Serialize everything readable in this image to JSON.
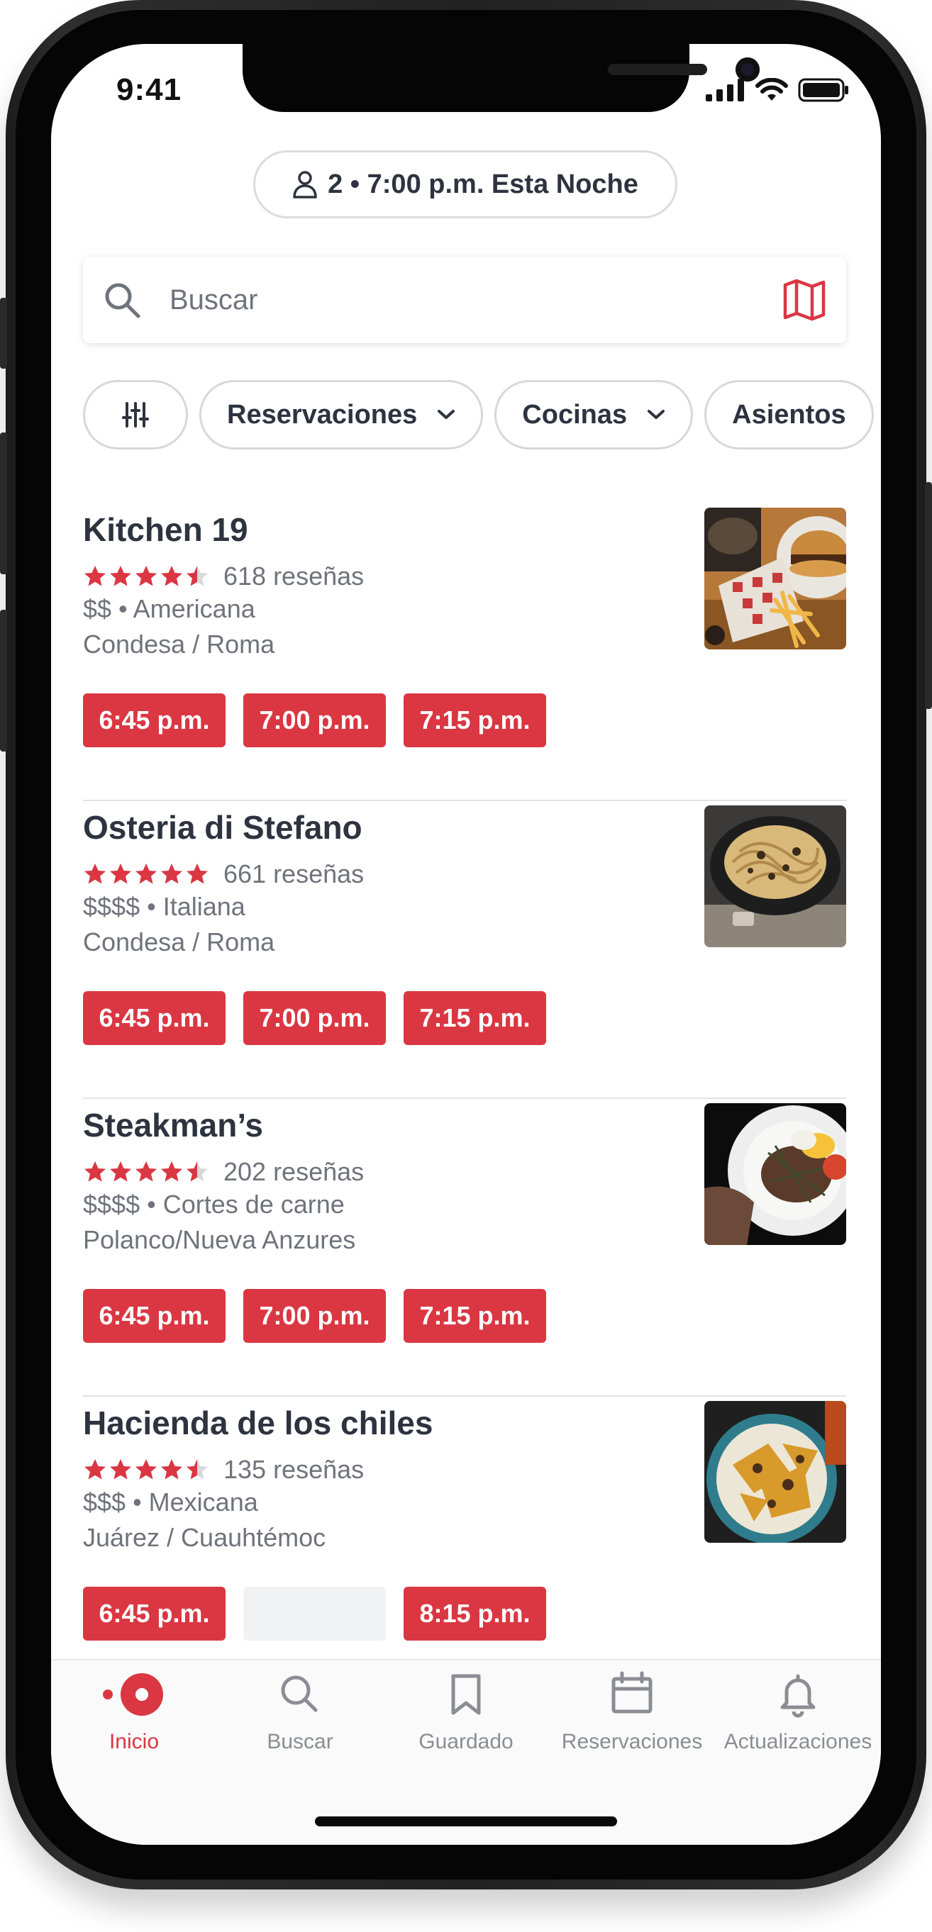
{
  "status_bar": {
    "time": "9:41"
  },
  "party": {
    "text": "2 • 7:00 p.m. Esta Noche"
  },
  "search": {
    "placeholder": "Buscar"
  },
  "filters": [
    {
      "label": "Reservaciones"
    },
    {
      "label": "Cocinas"
    },
    {
      "label": "Asientos"
    }
  ],
  "restaurants": [
    {
      "name": "Kitchen 19",
      "rating": 4.5,
      "reviews": "618 reseñas",
      "meta": "$$ • Americana",
      "neighborhood": "Condesa / Roma",
      "slots": [
        "6:45 p.m.",
        "7:00 p.m.",
        "7:15 p.m."
      ]
    },
    {
      "name": "Osteria di Stefano",
      "rating": 5,
      "reviews": "661 reseñas",
      "meta": "$$$$ • Italiana",
      "neighborhood": "Condesa / Roma",
      "slots": [
        "6:45 p.m.",
        "7:00 p.m.",
        "7:15 p.m."
      ]
    },
    {
      "name": "Steakman’s",
      "rating": 4.5,
      "reviews": "202 reseñas",
      "meta": "$$$$ • Cortes de carne",
      "neighborhood": "Polanco/Nueva Anzures",
      "slots": [
        "6:45 p.m.",
        "7:00 p.m.",
        "7:15 p.m."
      ]
    },
    {
      "name": "Hacienda de los chiles",
      "rating": 4.5,
      "reviews": "135 reseñas",
      "meta": "$$$ • Mexicana",
      "neighborhood": "Juárez / Cuauhtémoc",
      "slots": [
        "6:45 p.m.",
        "",
        "8:15 p.m."
      ]
    }
  ],
  "tabs": [
    {
      "label": "Inicio",
      "icon": "home-icon",
      "active": true
    },
    {
      "label": "Buscar",
      "icon": "search-icon",
      "active": false
    },
    {
      "label": "Guardado",
      "icon": "bookmark-icon",
      "active": false
    },
    {
      "label": "Reservaciones",
      "icon": "calendar-icon",
      "active": false
    },
    {
      "label": "Actualizaciones",
      "icon": "bell-icon",
      "active": false
    }
  ],
  "colors": {
    "accent": "#da3743",
    "text": "#2d333f",
    "secondary": "#6f737b"
  }
}
